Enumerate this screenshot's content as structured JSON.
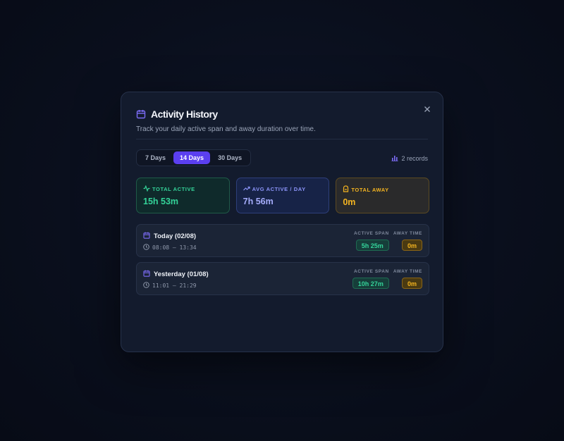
{
  "modal": {
    "title": "Activity History",
    "subtitle": "Track your daily active span and away duration over time."
  },
  "tabs": [
    {
      "label": "7 Days",
      "active": false
    },
    {
      "label": "14 Days",
      "active": true
    },
    {
      "label": "30 Days",
      "active": false
    }
  ],
  "records_label": "2 records",
  "stats": {
    "total_active": {
      "label": "TOTAL ACTIVE",
      "value": "15h 53m"
    },
    "avg_active": {
      "label": "AVG ACTIVE / DAY",
      "value": "7h 56m"
    },
    "total_away": {
      "label": "TOTAL AWAY",
      "value": "0m"
    }
  },
  "columns": {
    "active_span": "ACTIVE SPAN",
    "away_time": "AWAY TIME"
  },
  "history": [
    {
      "date": "Today (02/08)",
      "time_range": "08:08 – 13:34",
      "active_span": "5h 25m",
      "away_time": "0m"
    },
    {
      "date": "Yesterday (01/08)",
      "time_range": "11:01 – 21:29",
      "active_span": "10h 27m",
      "away_time": "0m"
    }
  ],
  "colors": {
    "accent": "#5b3ff0",
    "active_green": "#34d399",
    "avg_blue": "#8b93f8",
    "away_amber": "#f5b520"
  }
}
